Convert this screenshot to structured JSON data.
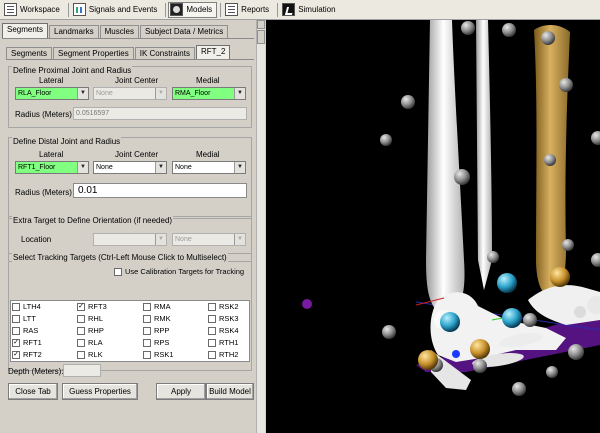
{
  "toolbar": {
    "tabs": [
      {
        "label": "Workspace",
        "icon": "workspace-icon"
      },
      {
        "label": "Signals and Events",
        "icon": "signals-icon"
      },
      {
        "label": "Models",
        "icon": "models-icon"
      },
      {
        "label": "Reports",
        "icon": "reports-icon"
      },
      {
        "label": "Simulation",
        "icon": "simulation-icon"
      }
    ],
    "active": "Models"
  },
  "main_tabs": [
    "Segments",
    "Landmarks",
    "Muscles",
    "Subject Data / Metrics"
  ],
  "sub_tabs": [
    "Segments",
    "Segment Properties",
    "IK Constraints",
    "RFT_2"
  ],
  "proximal": {
    "title": "Define Proximal Joint and Radius",
    "lateral_label": "Lateral",
    "center_label": "Joint Center",
    "medial_label": "Medial",
    "lateral_value": "RLA_Floor",
    "center_value": "None",
    "medial_value": "RMA_Floor",
    "radius_label": "Radius (Meters)",
    "radius_value": "0.0516597"
  },
  "distal": {
    "title": "Define Distal Joint and Radius",
    "lateral_label": "Lateral",
    "center_label": "Joint Center",
    "medial_label": "Medial",
    "lateral_value": "RFT1_Floor",
    "center_value": "None",
    "medial_value": "None",
    "radius_label": "Radius (Meters)",
    "radius_value": "0.01"
  },
  "extra": {
    "title": "Extra Target to Define Orientation (if needed)",
    "location_label": "Location",
    "location_value": "",
    "second_value": "None"
  },
  "tracking": {
    "title": "Select Tracking Targets (Ctrl-Left Mouse Click to Multiselect)",
    "calibration_label": "Use Calibration Targets for Tracking",
    "columns": [
      [
        {
          "label": "LTH4",
          "checked": false
        },
        {
          "label": "LTT",
          "checked": false
        },
        {
          "label": "RAS",
          "checked": false
        },
        {
          "label": "RFT1",
          "checked": true
        },
        {
          "label": "RFT2",
          "checked": true
        }
      ],
      [
        {
          "label": "RFT3",
          "checked": true
        },
        {
          "label": "RHL",
          "checked": false
        },
        {
          "label": "RHP",
          "checked": false
        },
        {
          "label": "RLA",
          "checked": false
        },
        {
          "label": "RLK",
          "checked": false
        }
      ],
      [
        {
          "label": "RMA",
          "checked": false
        },
        {
          "label": "RMK",
          "checked": false
        },
        {
          "label": "RPP",
          "checked": false
        },
        {
          "label": "RPS",
          "checked": false
        },
        {
          "label": "RSK1",
          "checked": false
        }
      ],
      [
        {
          "label": "RSK2",
          "checked": false
        },
        {
          "label": "RSK3",
          "checked": false
        },
        {
          "label": "RSK4",
          "checked": false
        },
        {
          "label": "RTH1",
          "checked": false
        },
        {
          "label": "RTH2",
          "checked": false
        }
      ]
    ]
  },
  "depth_label": "Depth (Meters):",
  "depth_value": "",
  "buttons": {
    "close_tab": "Close Tab",
    "guess": "Guess Properties",
    "apply": "Apply",
    "build": "Build Model"
  },
  "viewport": {
    "background": "#000000",
    "bone_color": "#f2f2f2",
    "selected_bone_color": "#c9a24c",
    "segment_color": "#6a1a9a"
  }
}
